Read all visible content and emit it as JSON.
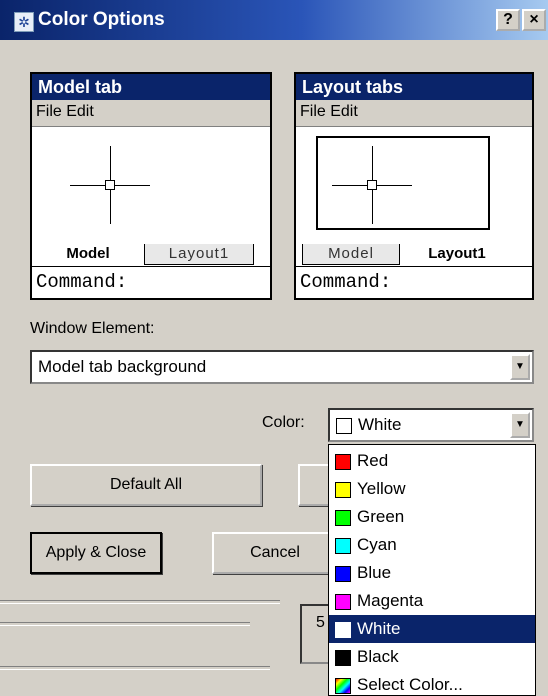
{
  "window": {
    "title": "Color Options",
    "help_label": "?",
    "close_label": "×"
  },
  "model_panel": {
    "title": "Model tab",
    "menu": "File  Edit",
    "tab_model": "Model",
    "tab_layout": "Layout1",
    "command": "Command:"
  },
  "layout_panel": {
    "title": "Layout tabs",
    "menu": "File  Edit",
    "tab_model": "Model",
    "tab_layout": "Layout1",
    "command": "Command:"
  },
  "window_element": {
    "label": "Window Element:",
    "value": "Model tab background"
  },
  "color": {
    "label": "Color:",
    "value": "White",
    "value_swatch": "#ffffff"
  },
  "buttons": {
    "default_all": "Default All",
    "apply_close": "Apply & Close",
    "cancel": "Cancel"
  },
  "partial_text": "5",
  "color_options": [
    {
      "label": "Red",
      "swatch": "#ff0000"
    },
    {
      "label": "Yellow",
      "swatch": "#ffff00"
    },
    {
      "label": "Green",
      "swatch": "#00ff00"
    },
    {
      "label": "Cyan",
      "swatch": "#00ffff"
    },
    {
      "label": "Blue",
      "swatch": "#0000ff"
    },
    {
      "label": "Magenta",
      "swatch": "#ff00ff"
    },
    {
      "label": "White",
      "swatch": "#ffffff",
      "selected": true
    },
    {
      "label": "Black",
      "swatch": "#000000"
    },
    {
      "label": "Select Color...",
      "swatch": "gradient"
    }
  ],
  "theme": {
    "title_bar": "#0a246a",
    "face": "#d4d0c8",
    "selection": "#0a246a"
  }
}
